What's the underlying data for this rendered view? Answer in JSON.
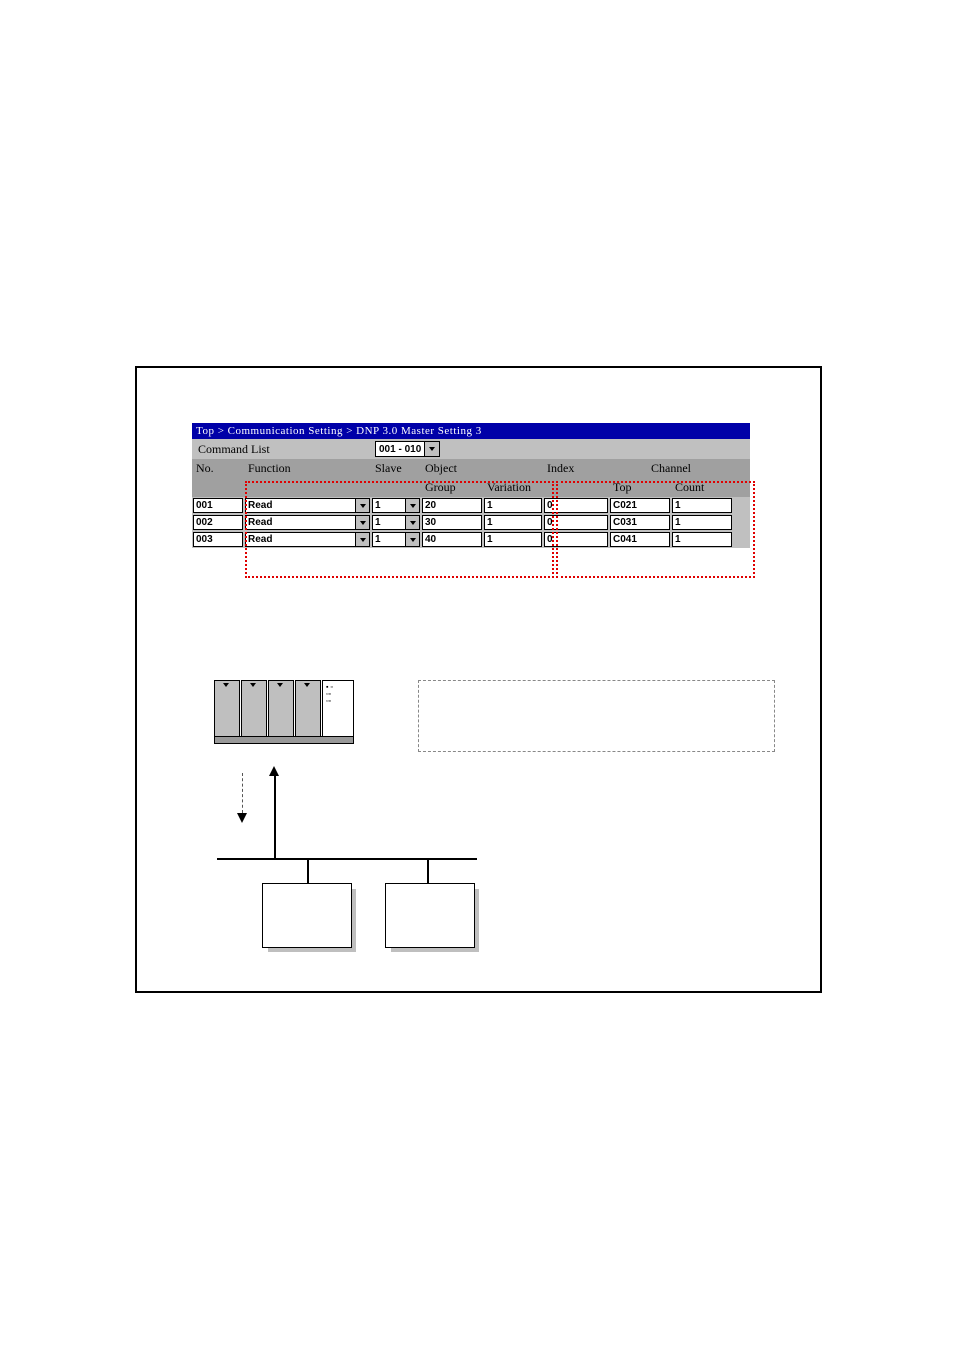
{
  "breadcrumb": "Top > Communication Setting > DNP 3.0 Master Setting 3",
  "commandListLabel": "Command List",
  "range": "001 - 010",
  "headers": {
    "no": "No.",
    "function": "Function",
    "slave": "Slave",
    "object": "Object",
    "group": "Group",
    "variation": "Variation",
    "index": "Index",
    "channel": "Channel",
    "top": "Top",
    "count": "Count"
  },
  "rows": [
    {
      "no": "001",
      "fn": "Read",
      "slave": "1",
      "group": "20",
      "variation": "1",
      "index": "0",
      "top": "C021",
      "count": "1"
    },
    {
      "no": "002",
      "fn": "Read",
      "slave": "1",
      "group": "30",
      "variation": "1",
      "index": "0",
      "top": "C031",
      "count": "1"
    },
    {
      "no": "003",
      "fn": "Read",
      "slave": "1",
      "group": "40",
      "variation": "1",
      "index": "0",
      "top": "C041",
      "count": "1"
    }
  ]
}
